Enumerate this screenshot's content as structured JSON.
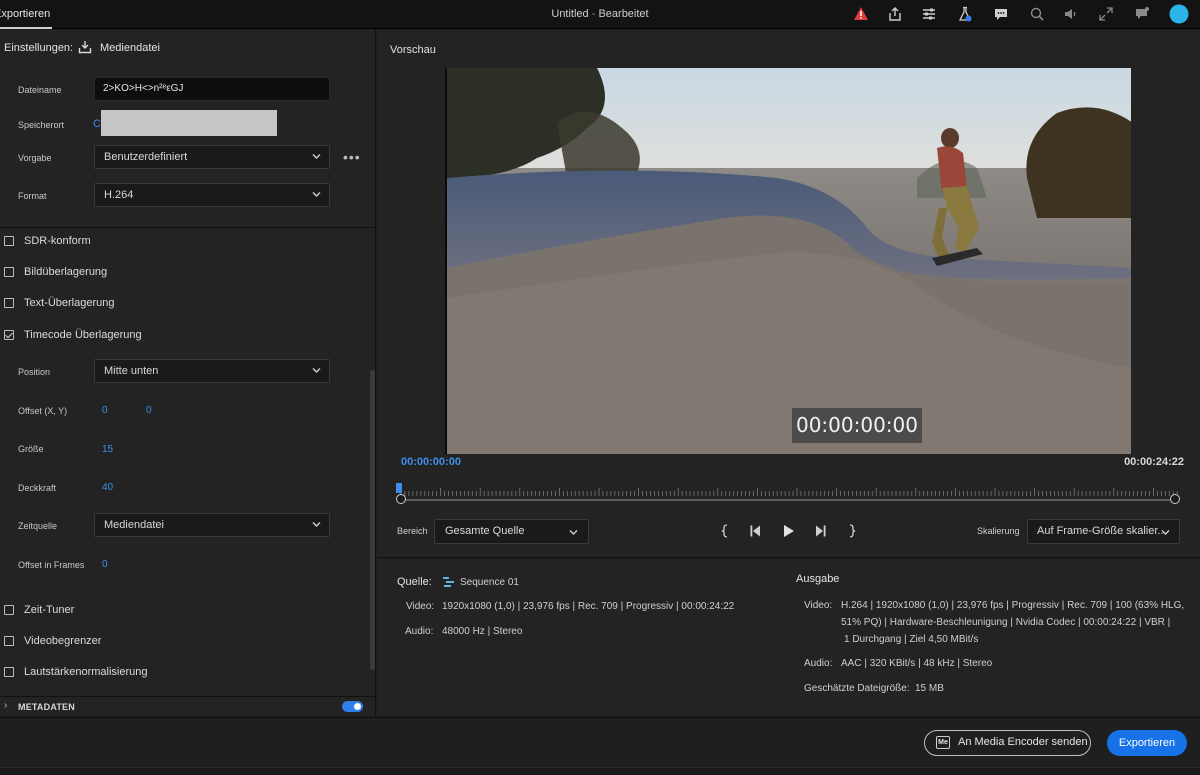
{
  "topbar": {
    "tab_export": "Exportieren",
    "doc_name": "Untitled",
    "doc_separator": " - ",
    "doc_status": "Bearbeitet"
  },
  "settings": {
    "label": "Einstellungen:",
    "target": "Mediendatei",
    "filename_label": "Dateiname",
    "filename_value": "2>KO>H<>n²ᵉεGJ",
    "location_label": "Speicherort",
    "location_value": "C",
    "preset_label": "Vorgabe",
    "preset_value": "Benutzerdefiniert",
    "more_label": "•••",
    "format_label": "Format",
    "format_value": "H.264"
  },
  "options": {
    "sdr": "SDR-konform",
    "image_overlay": "Bildüberlagerung",
    "text_overlay": "Text-Überlagerung",
    "timecode_overlay": "Timecode Überlagerung",
    "timecode_checked": true,
    "position_label": "Position",
    "position_value": "Mitte unten",
    "offset_label": "Offset (X, Y)",
    "offset_x": "0",
    "offset_y": "0",
    "size_label": "Größe",
    "size_value": "15",
    "opacity_label": "Deckkraft",
    "opacity_value": "40",
    "timesource_label": "Zeitquelle",
    "timesource_value": "Mediendatei",
    "offset_frames_label": "Offset in Frames",
    "offset_frames_value": "0",
    "time_tuner": "Zeit-Tuner",
    "video_limiter": "Videobegrenzer",
    "loudness": "Lautstärkenormalisierung",
    "metadata": "METADATEN",
    "metadata_enabled": true
  },
  "preview": {
    "title": "Vorschau",
    "overlay_timecode": "00:00:00:00",
    "current_time": "00:00:00:00",
    "duration": "00:00:24:22",
    "range_label": "Bereich",
    "range_value": "Gesamte Quelle",
    "scale_label": "Skalierung",
    "scale_value": "Auf Frame-Größe skalier..."
  },
  "source": {
    "heading": "Quelle:",
    "sequence": "Sequence 01",
    "video_key": "Video:",
    "video_val": "1920x1080 (1,0) | 23,976 fps | Rec. 709 | Progressiv | 00:00:24:22",
    "audio_key": "Audio:",
    "audio_val": "48000 Hz | Stereo"
  },
  "output": {
    "heading": "Ausgabe",
    "video_key": "Video:",
    "video_line1": "H.264 | 1920x1080 (1,0) | 23,976 fps | Progressiv | Rec. 709 | 100 (63% HLG,",
    "video_line2": "51% PQ) | Hardware-Beschleunigung | Nvidia Codec | 00:00:24:22  | VBR |",
    "video_line3": "1 Durchgang | Ziel 4,50 MBit/s",
    "audio_key": "Audio:",
    "audio_val": "AAC | 320 KBit/s | 48 kHz | Stereo",
    "size_key": "Geschätzte Dateigröße:",
    "size_val": "15 MB"
  },
  "footer": {
    "me_badge": "Me",
    "send_to_me": "An Media Encoder senden",
    "export": "Exportieren"
  },
  "colors": {
    "accent": "#1672e6",
    "link": "#3b8fe8",
    "warning": "#e03b3b",
    "avatar": "#2bb4e8"
  }
}
